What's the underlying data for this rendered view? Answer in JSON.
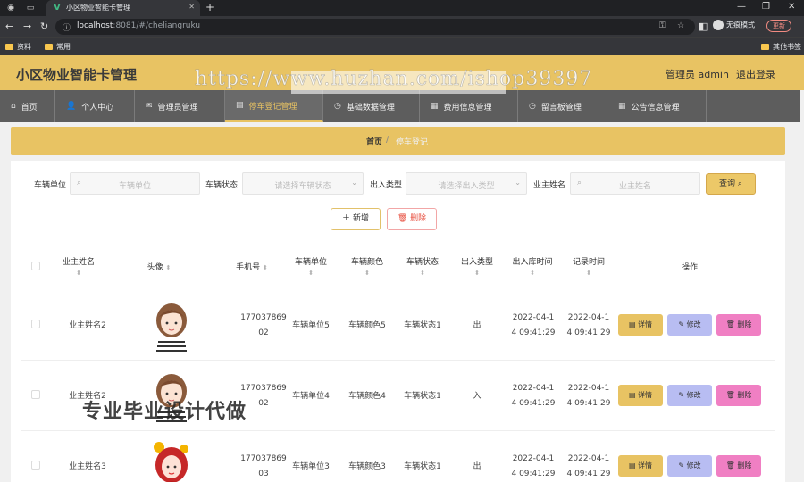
{
  "browser": {
    "tab_title": "小区物业智能卡管理",
    "url_host": "localhost",
    "url_rest": ":8081/#/cheliangruku",
    "profile": "无痕模式",
    "update": "更新",
    "bookmarks": [
      "资料",
      "常用"
    ],
    "other_bookmarks": "其他书签"
  },
  "header": {
    "title": "小区物业智能卡管理",
    "admin": "管理员 admin",
    "logout": "退出登录"
  },
  "watermarks": {
    "url": "https://www.huzhan.com/ishop39397",
    "caption": "专业毕业设计代做"
  },
  "nav": [
    {
      "icon": "⌂",
      "label": "首页"
    },
    {
      "icon": "👤",
      "label": "个人中心"
    },
    {
      "icon": "✉",
      "label": "管理员管理"
    },
    {
      "icon": "▤",
      "label": "停车登记管理"
    },
    {
      "icon": "◷",
      "label": "基础数据管理"
    },
    {
      "icon": "▦",
      "label": "费用信息管理"
    },
    {
      "icon": "◷",
      "label": "留言板管理"
    },
    {
      "icon": "▦",
      "label": "公告信息管理"
    }
  ],
  "breadcrumb": {
    "home": "首页",
    "sep": "/",
    "current": "停车登记"
  },
  "filters": {
    "unit_label": "车辆单位",
    "unit_placeholder": "车辆单位",
    "status_label": "车辆状态",
    "status_placeholder": "请选择车辆状态",
    "type_label": "出入类型",
    "type_placeholder": "请选择出入类型",
    "owner_label": "业主姓名",
    "owner_placeholder": "业主姓名",
    "query": "查询"
  },
  "actions": {
    "add": "新增",
    "delete": "删除"
  },
  "columns": [
    "业主姓名",
    "头像",
    "手机号",
    "车辆单位",
    "车辆颜色",
    "车辆状态",
    "出入类型",
    "出入库时间",
    "记录时间",
    "操作"
  ],
  "row_actions": {
    "detail": "详情",
    "edit": "修改",
    "delete": "删除"
  },
  "rows": [
    {
      "owner": "业主姓名2",
      "avatar": "avatar-girl-striped-shirt",
      "phone": "17703786902",
      "unit": "车辆单位5",
      "color": "车辆颜色5",
      "status": "车辆状态1",
      "type": "出",
      "io_time": "2022-04-14 09:41:29",
      "record_time": "2022-04-14 09:41:29"
    },
    {
      "owner": "业主姓名2",
      "avatar": "avatar-girl-striped-shirt",
      "phone": "17703786902",
      "unit": "车辆单位4",
      "color": "车辆颜色4",
      "status": "车辆状态1",
      "type": "入",
      "io_time": "2022-04-14 09:41:29",
      "record_time": "2022-04-14 09:41:29"
    },
    {
      "owner": "业主姓名3",
      "avatar": "avatar-girl-red-hair",
      "phone": "17703786903",
      "unit": "车辆单位3",
      "color": "车辆颜色3",
      "status": "车辆状态1",
      "type": "出",
      "io_time": "2022-04-14 09:41:29",
      "record_time": "2022-04-14 09:41:29"
    }
  ]
}
